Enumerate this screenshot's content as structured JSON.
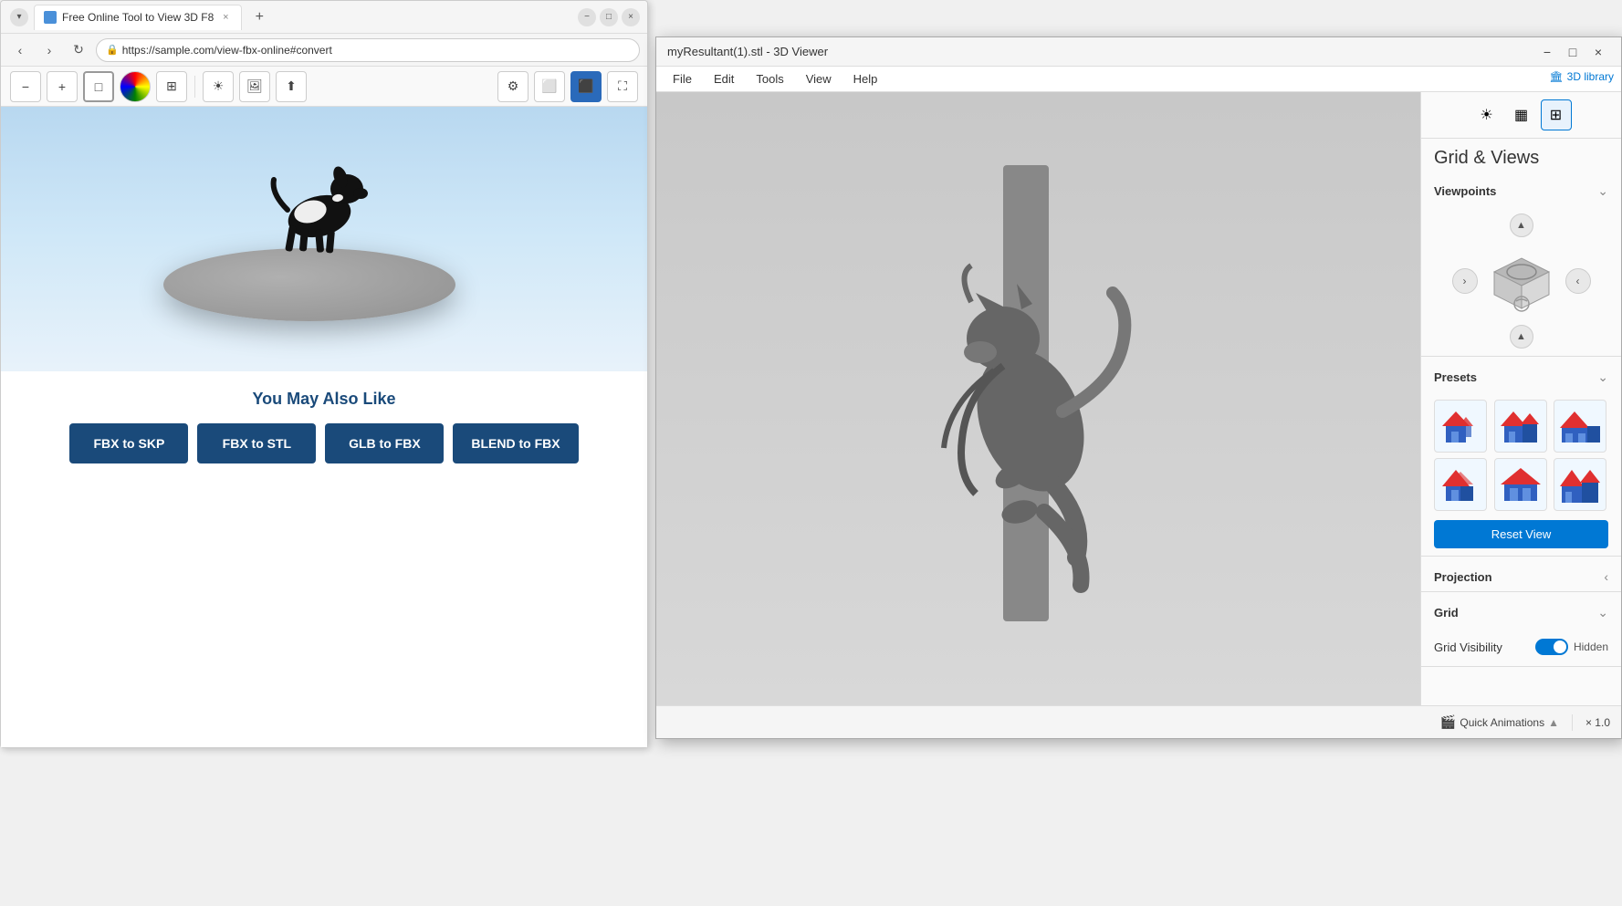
{
  "browser": {
    "tab_title": "Free Online Tool to View 3D F8",
    "url": "https://sample.com/view-fbx-online#convert",
    "favicon": "🌐"
  },
  "viewer_toolbar": {
    "tools": [
      {
        "name": "zoom-out",
        "icon": "−"
      },
      {
        "name": "zoom-in",
        "icon": "+"
      },
      {
        "name": "frame",
        "icon": "□"
      },
      {
        "name": "color",
        "icon": "◉"
      },
      {
        "name": "grid",
        "icon": "⊞"
      },
      {
        "name": "sun",
        "icon": "☀"
      },
      {
        "name": "image",
        "icon": "🖼"
      },
      {
        "name": "upload",
        "icon": "⬆"
      },
      {
        "name": "settings",
        "icon": "⚙"
      },
      {
        "name": "cube",
        "icon": "⬜"
      },
      {
        "name": "view",
        "icon": "⬛"
      },
      {
        "name": "fullscreen",
        "icon": "⛶"
      }
    ]
  },
  "viewer_scene": {
    "platform_description": "grey elliptical platform",
    "dog_description": "black and white dog figure"
  },
  "also_like": {
    "title": "You May Also Like",
    "buttons": [
      {
        "label": "FBX to SKP",
        "id": "fbx-skp"
      },
      {
        "label": "FBX to STL",
        "id": "fbx-stl"
      },
      {
        "label": "GLB to FBX",
        "id": "glb-fbx"
      },
      {
        "label": "BLEND to FBX",
        "id": "blend-fbx"
      }
    ]
  },
  "viewer_app": {
    "title": "myResultant(1).stl - 3D Viewer",
    "menu": [
      "File",
      "Edit",
      "Tools",
      "View",
      "Help"
    ],
    "library_label": "3D library",
    "panel": {
      "main_title": "Grid & Views",
      "icons": [
        {
          "name": "sun-icon",
          "icon": "☀",
          "active": false
        },
        {
          "name": "grid-view-icon",
          "icon": "▦",
          "active": false
        },
        {
          "name": "grid-views-icon",
          "icon": "⊞",
          "active": true
        }
      ],
      "sections": {
        "viewpoints": {
          "label": "Viewpoints",
          "expanded": true
        },
        "presets": {
          "label": "Presets",
          "expanded": true
        },
        "reset_view": {
          "label": "Reset View"
        },
        "projection": {
          "label": "Projection",
          "expanded": false
        },
        "grid": {
          "label": "Grid",
          "expanded": true,
          "visibility_label": "Grid Visibility",
          "hidden_label": "Hidden",
          "toggle_on": true
        }
      }
    },
    "bottom_bar": {
      "quick_animations": "Quick Animations",
      "speed": "× 1.0"
    }
  },
  "win_controls": {
    "minimize": "−",
    "maximize": "□",
    "close": "×"
  }
}
